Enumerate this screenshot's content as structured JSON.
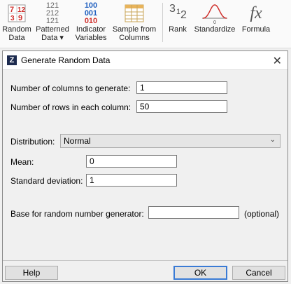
{
  "ribbon": {
    "random_data": {
      "label1": "Random",
      "label2": "Data",
      "nums": [
        "7",
        "12",
        "3",
        "9"
      ]
    },
    "patterned_data": {
      "label1": "Patterned",
      "label2": "Data ▾",
      "rows": [
        "121",
        "212",
        "121"
      ]
    },
    "indicator_variables": {
      "label1": "Indicator",
      "label2": "Variables",
      "rows": [
        "100",
        "001",
        "010"
      ]
    },
    "sample_from_columns": {
      "label1": "Sample from",
      "label2": "Columns"
    },
    "rank": {
      "label": "Rank",
      "glyph_a": "3",
      "glyph_b": "1",
      "glyph_c": "2"
    },
    "standardize": {
      "label": "Standardize",
      "axis_label": "0"
    },
    "formula": {
      "label": "Formula",
      "glyph": "fx"
    }
  },
  "dialog": {
    "title": "Generate Random Data",
    "fields": {
      "num_columns": {
        "label": "Number of columns to generate:",
        "value": "1"
      },
      "num_rows": {
        "label": "Number of rows in each column:",
        "value": "50"
      },
      "distribution": {
        "label": "Distribution:",
        "value": "Normal"
      },
      "mean": {
        "label": "Mean:",
        "value": "0"
      },
      "std_dev": {
        "label": "Standard deviation:",
        "value": "1"
      },
      "base": {
        "label": "Base for random number generator:",
        "value": "",
        "hint": "(optional)"
      }
    },
    "buttons": {
      "help": "Help",
      "ok": "OK",
      "cancel": "Cancel"
    }
  },
  "colors": {
    "red": "#d0312d",
    "blue": "#1f5fbf",
    "accent": "#3a7bd5"
  }
}
